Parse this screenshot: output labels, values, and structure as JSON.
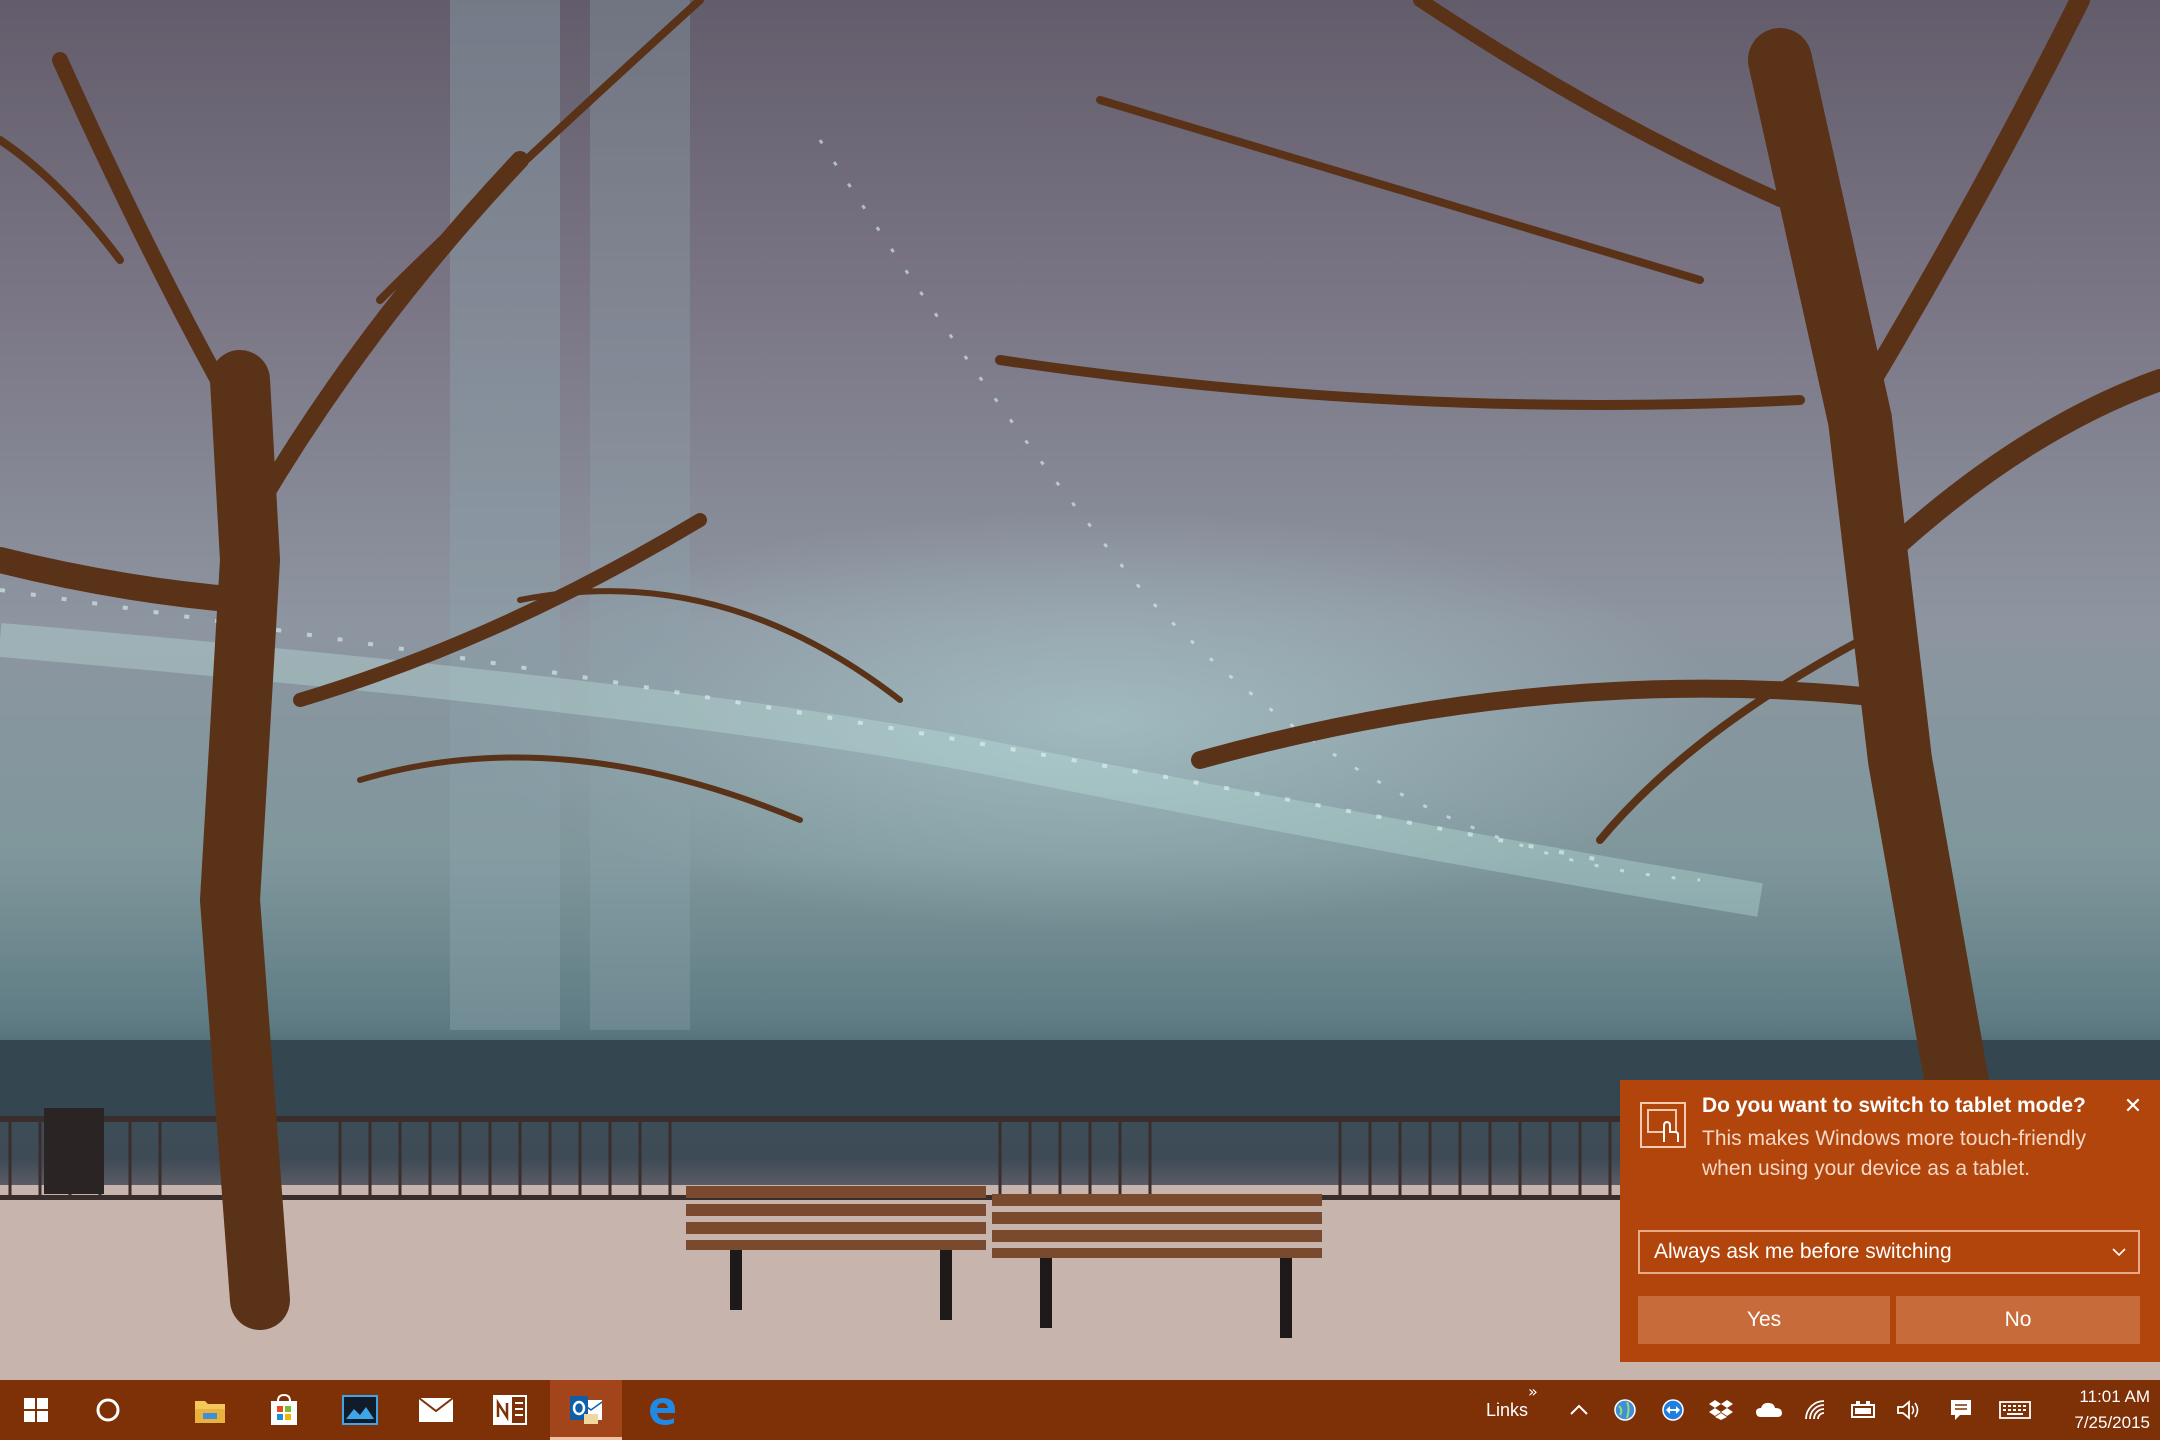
{
  "toast": {
    "title": "Do you want to switch to tablet mode?",
    "body": "This makes Windows more touch-friendly when using your device as a tablet.",
    "dropdown_value": "Always ask me before switching",
    "yes_label": "Yes",
    "no_label": "No",
    "accent": "#b2450c"
  },
  "taskbar": {
    "color": "#7e3007",
    "apps": [
      "start",
      "cortana",
      "file-explorer",
      "store",
      "photos",
      "mail",
      "onenote",
      "outlook",
      "edge"
    ],
    "links_label": "Links",
    "clock": {
      "time": "11:01 AM",
      "date": "7/25/2015"
    }
  }
}
